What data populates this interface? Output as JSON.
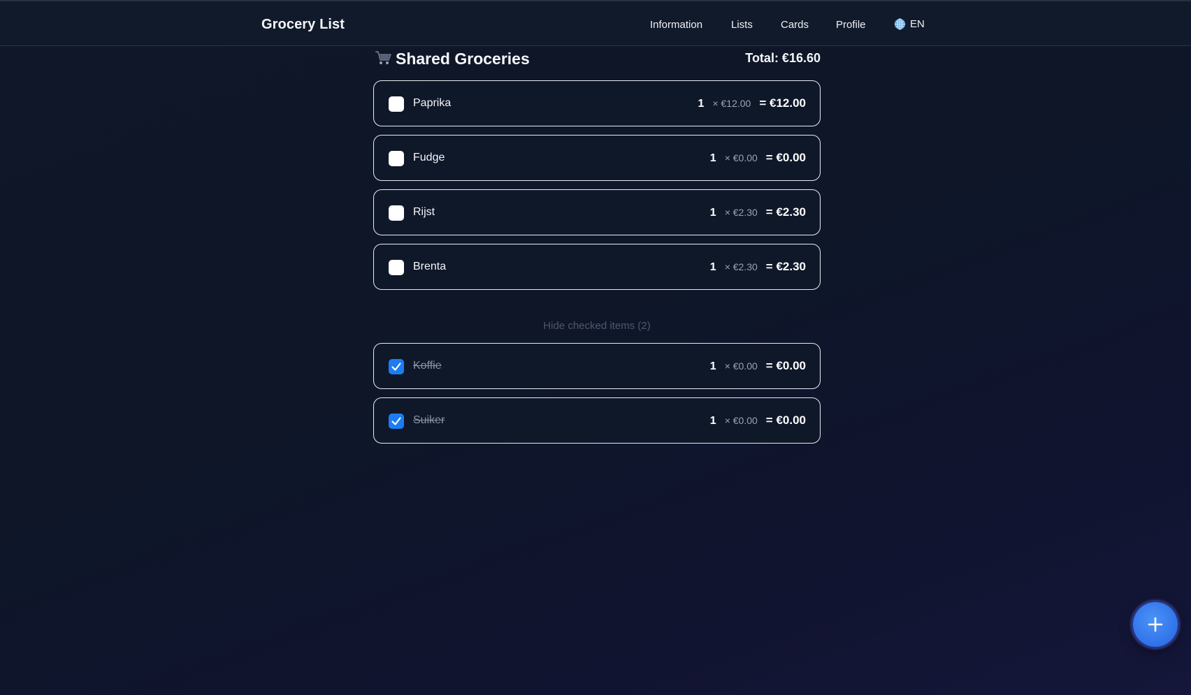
{
  "topbar": {
    "brand": "Grocery List",
    "nav": [
      {
        "label": "Information"
      },
      {
        "label": "Lists"
      },
      {
        "label": "Cards"
      },
      {
        "label": "Profile"
      }
    ],
    "language": "EN"
  },
  "list": {
    "title": "Shared Groceries",
    "total": "Total: €16.60",
    "icon": "shopping-cart-icon"
  },
  "items": [
    {
      "name": "Paprika",
      "qty": "1",
      "unit_price": "× €12.00",
      "line_total": "= €12.00",
      "checked": false
    },
    {
      "name": "Fudge",
      "qty": "1",
      "unit_price": "× €0.00",
      "line_total": "= €0.00",
      "checked": false
    },
    {
      "name": "Rijst",
      "qty": "1",
      "unit_price": "× €2.30",
      "line_total": "= €2.30",
      "checked": false
    },
    {
      "name": "Brenta",
      "qty": "1",
      "unit_price": "× €2.30",
      "line_total": "= €2.30",
      "checked": false
    }
  ],
  "hide_checked": {
    "label": "Hide checked items (2)"
  },
  "checked_items": [
    {
      "name": "Koffie",
      "qty": "1",
      "unit_price": "× €0.00",
      "line_total": "= €0.00",
      "checked": true
    },
    {
      "name": "Suiker",
      "qty": "1",
      "unit_price": "× €0.00",
      "line_total": "= €0.00",
      "checked": true
    }
  ],
  "fab": {
    "icon": "plus-icon"
  },
  "colors": {
    "background": "#0f1728",
    "accent": "#1d7cf2",
    "fab": "#3b82f6",
    "card_border": "#e9ecf2"
  }
}
